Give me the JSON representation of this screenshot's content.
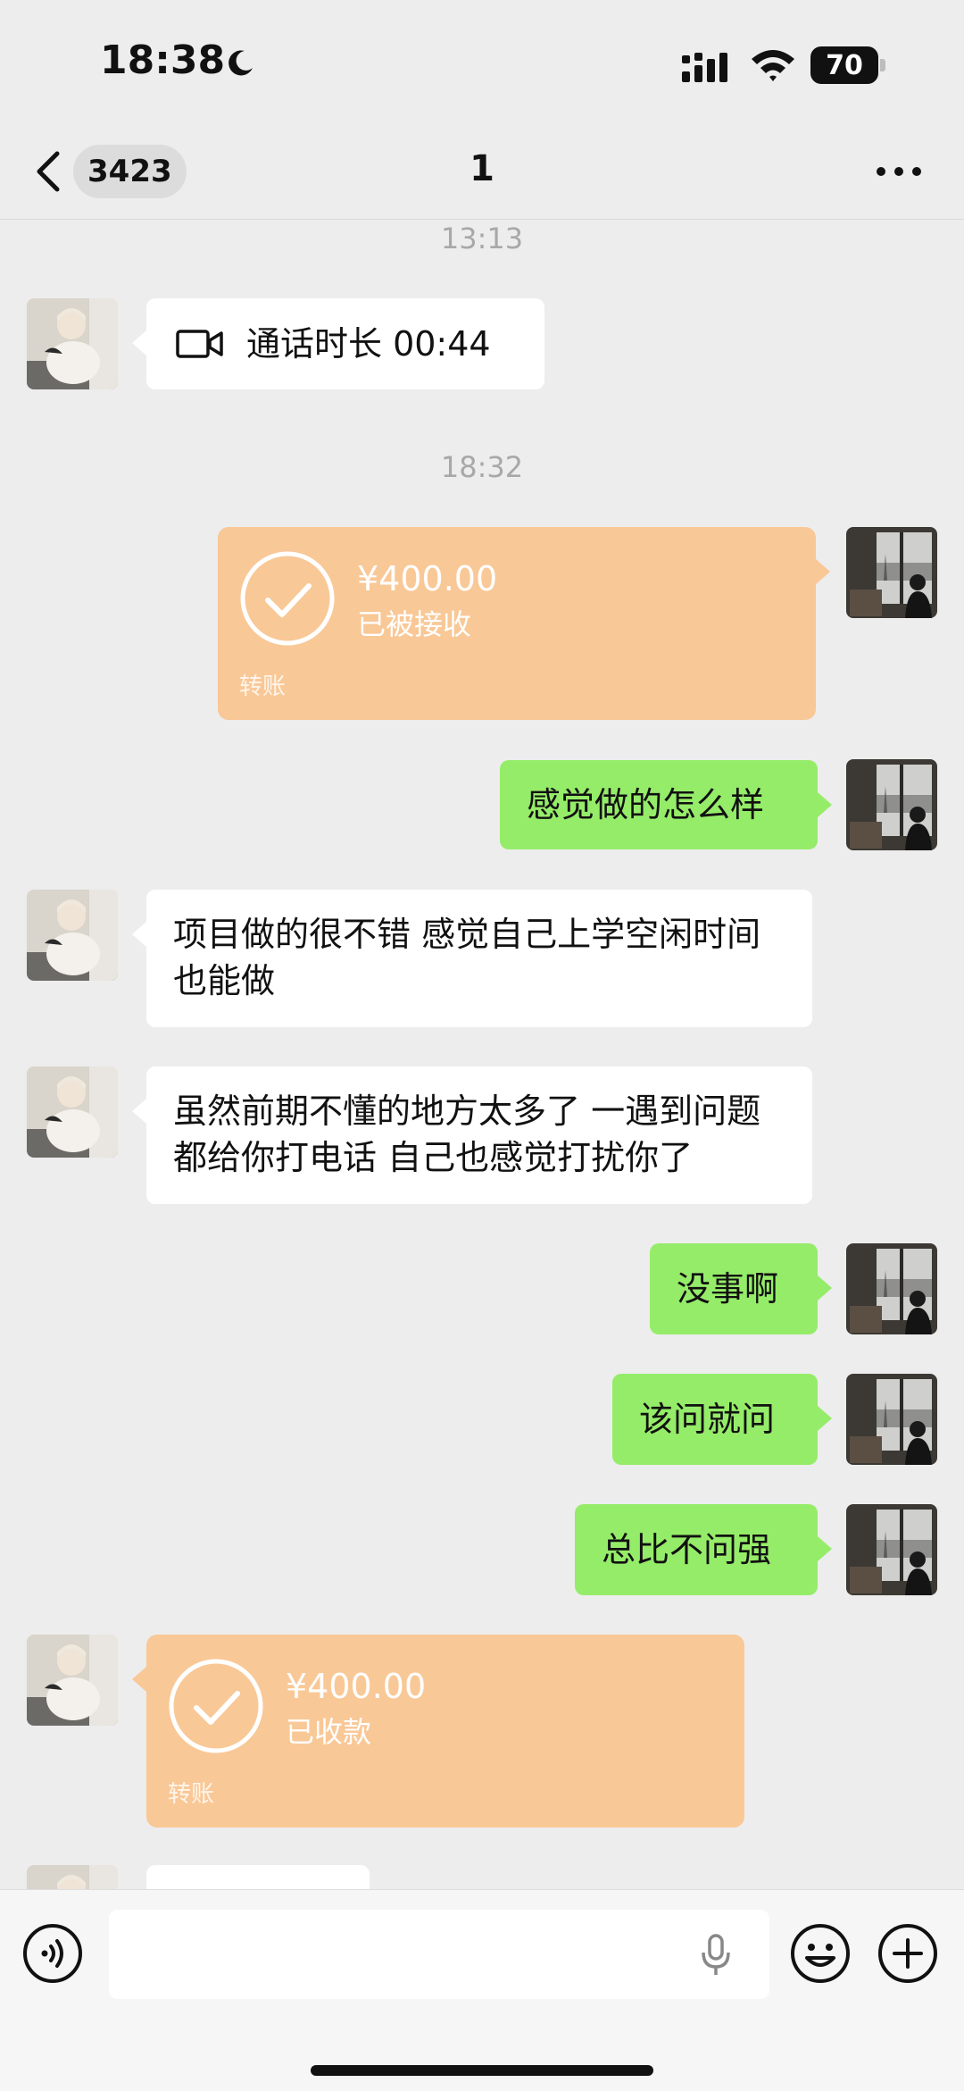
{
  "status_bar": {
    "time": "18:38",
    "battery": "70"
  },
  "nav": {
    "unread_count": "3423",
    "title": "1"
  },
  "messages": {
    "ts1": "13:13",
    "call_text": "通话时长 00:44",
    "ts2": "18:32",
    "transfer_out": {
      "amount": "¥400.00",
      "status": "已被接收",
      "label": "转账"
    },
    "m1": "感觉做的怎么样",
    "m2": "项目做的很不错 感觉自己上学空闲时间也能做",
    "m3": "虽然前期不懂的地方太多了 一遇到问题都给你打电话 自己也感觉打扰你了",
    "m4": "没事啊",
    "m5": "该问就问",
    "m6": "总比不问强",
    "transfer_in": {
      "amount": "¥400.00",
      "status": "已收款",
      "label": "转账"
    }
  },
  "input": {
    "placeholder": ""
  },
  "colors": {
    "background": "#ededed",
    "sent_bubble": "#95ec69",
    "received_bubble": "#ffffff",
    "transfer": "#f9c897"
  },
  "icons": [
    "moon-icon",
    "signal-icon",
    "wifi-icon",
    "back-icon",
    "more-icon",
    "video-call-icon",
    "check-icon",
    "voice-icon",
    "mic-icon",
    "emoji-icon",
    "plus-icon"
  ]
}
